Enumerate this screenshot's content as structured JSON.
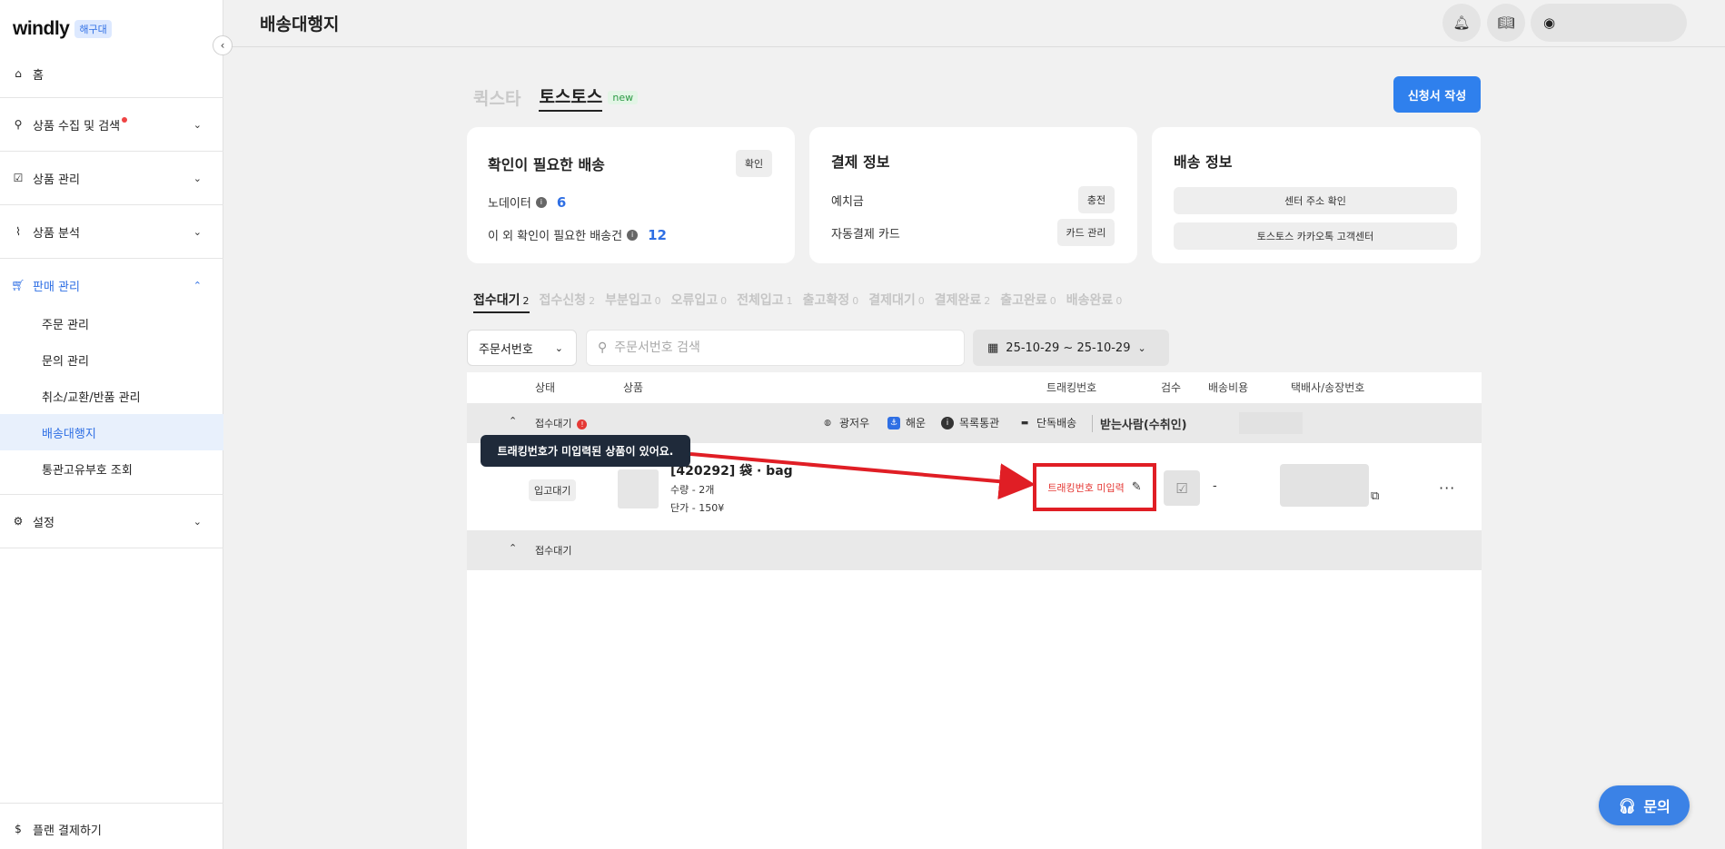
{
  "brand": {
    "logo": "windly",
    "badge": "해구대"
  },
  "sidebar": {
    "items": [
      {
        "label": "홈"
      },
      {
        "label": "상품 수집 및 검색"
      },
      {
        "label": "상품 관리"
      },
      {
        "label": "상품 분석"
      },
      {
        "label": "판매 관리"
      },
      {
        "label": "설정"
      }
    ],
    "sub_items": [
      {
        "label": "주문 관리"
      },
      {
        "label": "문의 관리"
      },
      {
        "label": "취소/교환/반품 관리"
      },
      {
        "label": "배송대행지"
      },
      {
        "label": "통관고유부호 조회"
      }
    ],
    "plan": "플랜 결제하기"
  },
  "header": {
    "title": "배송대행지"
  },
  "service_tabs": [
    {
      "label": "퀵스타"
    },
    {
      "label": "토스토스"
    }
  ],
  "new_badge": "new",
  "create_button": "신청서 작성",
  "cards": {
    "confirm": {
      "title": "확인이 필요한 배송",
      "button": "확인",
      "row1_label": "노데이터",
      "row1_value": "6",
      "row2_label": "이 외 확인이 필요한 배송건",
      "row2_value": "12"
    },
    "payment": {
      "title": "결제 정보",
      "row1_label": "예치금",
      "row1_button": "충전",
      "row2_label": "자동결제 카드",
      "row2_button": "카드 관리"
    },
    "shipping": {
      "title": "배송 정보",
      "btn1": "센터 주소 확인",
      "btn2": "토스토스 카카오톡 고객센터"
    }
  },
  "status_tabs": [
    {
      "label": "접수대기",
      "count": "2"
    },
    {
      "label": "접수신청",
      "count": "2"
    },
    {
      "label": "부분입고",
      "count": "0"
    },
    {
      "label": "오류입고",
      "count": "0"
    },
    {
      "label": "전체입고",
      "count": "1"
    },
    {
      "label": "출고확정",
      "count": "0"
    },
    {
      "label": "결제대기",
      "count": "0"
    },
    {
      "label": "결제완료",
      "count": "2"
    },
    {
      "label": "출고완료",
      "count": "0"
    },
    {
      "label": "배송완료",
      "count": "0"
    }
  ],
  "filters": {
    "select_value": "주문서번호",
    "search_placeholder": "주문서번호 검색",
    "date_range": "25-10-29 ~ 25-10-29"
  },
  "table": {
    "headers": {
      "status": "상태",
      "product": "상품",
      "tracking": "트래킹번호",
      "inspect": "검수",
      "cost": "배송비용",
      "carrier": "택배사/송장번호"
    },
    "group1": {
      "label": "접수대기",
      "error": "!",
      "meta1": "광저우",
      "meta2": "해운",
      "meta3": "목록통관",
      "meta4": "단독배송",
      "recipient": "받는사람(수취인)"
    },
    "group2": {
      "label": "접수대기"
    },
    "row": {
      "status": "입고대기",
      "product_name": "[420292] 袋 · bag",
      "qty_label": "수량",
      "qty_value": "2개",
      "price_label": "단가",
      "price_value": "150¥",
      "tracking": "트래킹번호 미입력",
      "cost": "-"
    }
  },
  "tooltip": "트래킹번호가 미입력된 상품이 있어요.",
  "fab": "문의",
  "colors": {
    "accent": "#2f80ed",
    "highlight": "#e01e25",
    "tooltip_bg": "#1f2a3a"
  }
}
